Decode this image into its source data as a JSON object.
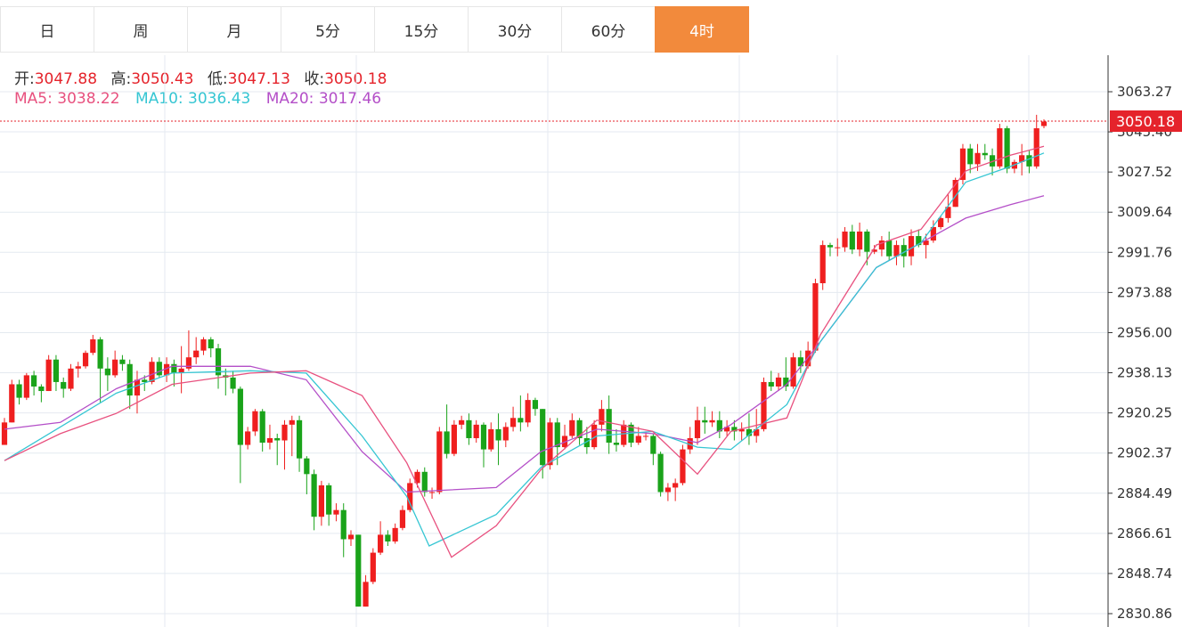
{
  "tabs": [
    {
      "label": "日",
      "active": false
    },
    {
      "label": "周",
      "active": false
    },
    {
      "label": "月",
      "active": false
    },
    {
      "label": "5分",
      "active": false
    },
    {
      "label": "15分",
      "active": false
    },
    {
      "label": "30分",
      "active": false
    },
    {
      "label": "60分",
      "active": false
    },
    {
      "label": "4时",
      "active": true
    }
  ],
  "colors": {
    "up": "#ef1f1f",
    "down": "#1aa31a",
    "ma5": "#e8517f",
    "ma10": "#36c6d3",
    "ma20": "#b44fc8",
    "active_tab": "#f28a3c",
    "grid": "#e4eaf0",
    "price_line": "#e5232b"
  },
  "ohlc": {
    "open_label": "开:",
    "open_value": "3047.88",
    "high_label": "高:",
    "high_value": "3050.43",
    "low_label": "低:",
    "low_value": "3047.13",
    "close_label": "收:",
    "close_value": "3050.18"
  },
  "ma": {
    "ma5_label": "MA5:",
    "ma5_value": "3038.22",
    "ma10_label": "MA10:",
    "ma10_value": "3036.43",
    "ma20_label": "MA20:",
    "ma20_value": "3017.46"
  },
  "current_price_label": "3050.18",
  "chart_data": {
    "type": "candlestick",
    "y_ticks": [
      "3063.27",
      "3045.40",
      "3027.52",
      "3009.64",
      "2991.76",
      "2973.88",
      "2956.00",
      "2938.13",
      "2920.25",
      "2902.37",
      "2884.49",
      "2866.61",
      "2848.74",
      "2830.86"
    ],
    "ylim": [
      2830.86,
      3063.27
    ],
    "current_price": 3050.18,
    "candles": [
      [
        2906,
        2916,
        2906,
        2918
      ],
      [
        2916,
        2933,
        2916,
        2935
      ],
      [
        2933,
        2927,
        2924,
        2935
      ],
      [
        2927,
        2937,
        2926,
        2938
      ],
      [
        2937,
        2932,
        2928,
        2939
      ],
      [
        2932,
        2930,
        2925,
        2933
      ],
      [
        2930,
        2944,
        2930,
        2946
      ],
      [
        2944,
        2934,
        2930,
        2946
      ],
      [
        2934,
        2931,
        2927,
        2936
      ],
      [
        2931,
        2940,
        2930,
        2942
      ],
      [
        2940,
        2941,
        2936,
        2943
      ],
      [
        2941,
        2947,
        2940,
        2948
      ],
      [
        2947,
        2953,
        2946,
        2955
      ],
      [
        2953,
        2940,
        2925,
        2954
      ],
      [
        2940,
        2937,
        2930,
        2945
      ],
      [
        2937,
        2944,
        2936,
        2948
      ],
      [
        2944,
        2942,
        2939,
        2946
      ],
      [
        2942,
        2928,
        2922,
        2944
      ],
      [
        2928,
        2935,
        2920,
        2939
      ],
      [
        2935,
        2934,
        2930,
        2937
      ],
      [
        2934,
        2943,
        2933,
        2945
      ],
      [
        2943,
        2937,
        2936,
        2945
      ],
      [
        2937,
        2942,
        2934,
        2945
      ],
      [
        2942,
        2938,
        2932,
        2944
      ],
      [
        2938,
        2940,
        2929,
        2950
      ],
      [
        2940,
        2945,
        2939,
        2957
      ],
      [
        2945,
        2948,
        2942,
        2954
      ],
      [
        2948,
        2953,
        2946,
        2954
      ],
      [
        2953,
        2949,
        2945,
        2954
      ],
      [
        2949,
        2937,
        2931,
        2951
      ],
      [
        2937,
        2936,
        2928,
        2940
      ],
      [
        2936,
        2931,
        2929,
        2939
      ],
      [
        2931,
        2906,
        2889,
        2932
      ],
      [
        2906,
        2912,
        2904,
        2914
      ],
      [
        2912,
        2921,
        2910,
        2922
      ],
      [
        2921,
        2907,
        2903,
        2922
      ],
      [
        2907,
        2909,
        2904,
        2915
      ],
      [
        2909,
        2908,
        2897,
        2911
      ],
      [
        2908,
        2915,
        2895,
        2917
      ],
      [
        2915,
        2917,
        2901,
        2919
      ],
      [
        2917,
        2900,
        2894,
        2919
      ],
      [
        2900,
        2893,
        2884,
        2901
      ],
      [
        2893,
        2874,
        2868,
        2895
      ],
      [
        2874,
        2888,
        2870,
        2890
      ],
      [
        2888,
        2875,
        2870,
        2889
      ],
      [
        2875,
        2877,
        2872,
        2880
      ],
      [
        2877,
        2864,
        2856,
        2880
      ],
      [
        2864,
        2866,
        2861,
        2868
      ],
      [
        2866,
        2834,
        2834,
        2866
      ],
      [
        2834,
        2845,
        2834,
        2848
      ],
      [
        2845,
        2858,
        2844,
        2860
      ],
      [
        2858,
        2866,
        2857,
        2872
      ],
      [
        2866,
        2863,
        2861,
        2868
      ],
      [
        2863,
        2869,
        2862,
        2871
      ],
      [
        2869,
        2877,
        2868,
        2879
      ],
      [
        2877,
        2889,
        2876,
        2891
      ],
      [
        2889,
        2894,
        2887,
        2895
      ],
      [
        2894,
        2885,
        2883,
        2896
      ],
      [
        2885,
        2885,
        2882,
        2887
      ],
      [
        2885,
        2912,
        2884,
        2914
      ],
      [
        2912,
        2902,
        2900,
        2924
      ],
      [
        2902,
        2915,
        2901,
        2917
      ],
      [
        2915,
        2917,
        2913,
        2919
      ],
      [
        2917,
        2909,
        2906,
        2920
      ],
      [
        2909,
        2915,
        2907,
        2917
      ],
      [
        2915,
        2904,
        2896,
        2916
      ],
      [
        2904,
        2913,
        2903,
        2916
      ],
      [
        2913,
        2908,
        2897,
        2920
      ],
      [
        2908,
        2914,
        2905,
        2916
      ],
      [
        2914,
        2918,
        2912,
        2923
      ],
      [
        2918,
        2916,
        2912,
        2928
      ],
      [
        2916,
        2926,
        2914,
        2929
      ],
      [
        2926,
        2922,
        2919,
        2927
      ],
      [
        2922,
        2897,
        2891,
        2922
      ],
      [
        2897,
        2916,
        2895,
        2918
      ],
      [
        2916,
        2905,
        2897,
        2918
      ],
      [
        2905,
        2910,
        2904,
        2915
      ],
      [
        2910,
        2917,
        2909,
        2920
      ],
      [
        2917,
        2909,
        2906,
        2918
      ],
      [
        2909,
        2905,
        2902,
        2914
      ],
      [
        2905,
        2915,
        2904,
        2917
      ],
      [
        2915,
        2922,
        2912,
        2926
      ],
      [
        2922,
        2907,
        2902,
        2928
      ],
      [
        2907,
        2906,
        2903,
        2913
      ],
      [
        2906,
        2915,
        2905,
        2917
      ],
      [
        2915,
        2907,
        2905,
        2916
      ],
      [
        2907,
        2910,
        2906,
        2914
      ],
      [
        2910,
        2910,
        2908,
        2912
      ],
      [
        2910,
        2902,
        2897,
        2911
      ],
      [
        2902,
        2885,
        2883,
        2903
      ],
      [
        2885,
        2887,
        2881,
        2889
      ],
      [
        2887,
        2889,
        2881,
        2891
      ],
      [
        2889,
        2904,
        2888,
        2906
      ],
      [
        2904,
        2909,
        2902,
        2914
      ],
      [
        2909,
        2917,
        2906,
        2923
      ],
      [
        2917,
        2916,
        2911,
        2923
      ],
      [
        2916,
        2917,
        2914,
        2921
      ],
      [
        2917,
        2912,
        2909,
        2921
      ],
      [
        2912,
        2914,
        2910,
        2917
      ],
      [
        2914,
        2912,
        2908,
        2917
      ],
      [
        2912,
        2913,
        2908,
        2916
      ],
      [
        2913,
        2910,
        2906,
        2920
      ],
      [
        2910,
        2913,
        2907,
        2922
      ],
      [
        2913,
        2934,
        2912,
        2936
      ],
      [
        2934,
        2932,
        2930,
        2939
      ],
      [
        2932,
        2936,
        2930,
        2938
      ],
      [
        2936,
        2932,
        2930,
        2945
      ],
      [
        2932,
        2945,
        2931,
        2947
      ],
      [
        2945,
        2941,
        2938,
        2948
      ],
      [
        2941,
        2948,
        2940,
        2952
      ],
      [
        2948,
        2978,
        2947,
        2980
      ],
      [
        2978,
        2995,
        2975,
        2997
      ],
      [
        2995,
        2994,
        2990,
        2996
      ],
      [
        2994,
        2994,
        2990,
        2998
      ],
      [
        2994,
        3001,
        2992,
        3003
      ],
      [
        3001,
        2993,
        2991,
        3004
      ],
      [
        2993,
        3001,
        2990,
        3005
      ],
      [
        3001,
        2992,
        2986,
        3002
      ],
      [
        2992,
        2993,
        2991,
        2995
      ],
      [
        2993,
        2997,
        2990,
        2999
      ],
      [
        2997,
        2990,
        2988,
        3001
      ],
      [
        2990,
        2995,
        2986,
        2997
      ],
      [
        2995,
        2990,
        2985,
        2998
      ],
      [
        2990,
        2999,
        2986,
        3002
      ],
      [
        2999,
        2995,
        2994,
        3002
      ],
      [
        2995,
        2997,
        2989,
        3000
      ],
      [
        2997,
        3003,
        2996,
        3006
      ],
      [
        3003,
        3007,
        3002,
        3008
      ],
      [
        3007,
        3012,
        3005,
        3018
      ],
      [
        3012,
        3024,
        3012,
        3025
      ],
      [
        3024,
        3038,
        3022,
        3040
      ],
      [
        3038,
        3031,
        3027,
        3040
      ],
      [
        3031,
        3036,
        3028,
        3040
      ],
      [
        3036,
        3035,
        3033,
        3040
      ],
      [
        3035,
        3030,
        3026,
        3038
      ],
      [
        3030,
        3047,
        3029,
        3049
      ],
      [
        3047,
        3029,
        3027,
        3048
      ],
      [
        3029,
        3032,
        3027,
        3033
      ],
      [
        3032,
        3035,
        3026,
        3040
      ],
      [
        3035,
        3030,
        3027,
        3037
      ],
      [
        3030,
        3047,
        3029,
        3053
      ],
      [
        3048,
        3050,
        3047,
        3051
      ]
    ],
    "ma5": [
      [
        0,
        2899
      ],
      [
        0.05,
        2911
      ],
      [
        0.1,
        2920
      ],
      [
        0.15,
        2933
      ],
      [
        0.22,
        2938
      ],
      [
        0.27,
        2939
      ],
      [
        0.32,
        2928
      ],
      [
        0.36,
        2898
      ],
      [
        0.4,
        2856
      ],
      [
        0.44,
        2870
      ],
      [
        0.48,
        2895
      ],
      [
        0.53,
        2917
      ],
      [
        0.58,
        2912
      ],
      [
        0.62,
        2893
      ],
      [
        0.65,
        2912
      ],
      [
        0.7,
        2918
      ],
      [
        0.73,
        2955
      ],
      [
        0.78,
        2995
      ],
      [
        0.82,
        3002
      ],
      [
        0.86,
        3028
      ],
      [
        0.9,
        3035
      ],
      [
        0.93,
        3039
      ]
    ],
    "ma10": [
      [
        0,
        2899
      ],
      [
        0.05,
        2914
      ],
      [
        0.1,
        2929
      ],
      [
        0.15,
        2938
      ],
      [
        0.22,
        2939
      ],
      [
        0.27,
        2938
      ],
      [
        0.32,
        2910
      ],
      [
        0.36,
        2883
      ],
      [
        0.38,
        2861
      ],
      [
        0.44,
        2875
      ],
      [
        0.48,
        2896
      ],
      [
        0.53,
        2910
      ],
      [
        0.58,
        2912
      ],
      [
        0.62,
        2905
      ],
      [
        0.65,
        2904
      ],
      [
        0.7,
        2924
      ],
      [
        0.73,
        2952
      ],
      [
        0.78,
        2985
      ],
      [
        0.82,
        2996
      ],
      [
        0.86,
        3023
      ],
      [
        0.9,
        3030
      ],
      [
        0.93,
        3036
      ]
    ],
    "ma20": [
      [
        0,
        2913
      ],
      [
        0.05,
        2916
      ],
      [
        0.1,
        2931
      ],
      [
        0.15,
        2941
      ],
      [
        0.22,
        2941
      ],
      [
        0.27,
        2935
      ],
      [
        0.32,
        2903
      ],
      [
        0.36,
        2885
      ],
      [
        0.44,
        2887
      ],
      [
        0.48,
        2903
      ],
      [
        0.53,
        2913
      ],
      [
        0.58,
        2911
      ],
      [
        0.62,
        2907
      ],
      [
        0.65,
        2915
      ],
      [
        0.7,
        2933
      ],
      [
        0.73,
        2952
      ],
      [
        0.78,
        2985
      ],
      [
        0.82,
        2996
      ],
      [
        0.86,
        3007
      ],
      [
        0.9,
        3013
      ],
      [
        0.93,
        3017
      ]
    ]
  }
}
